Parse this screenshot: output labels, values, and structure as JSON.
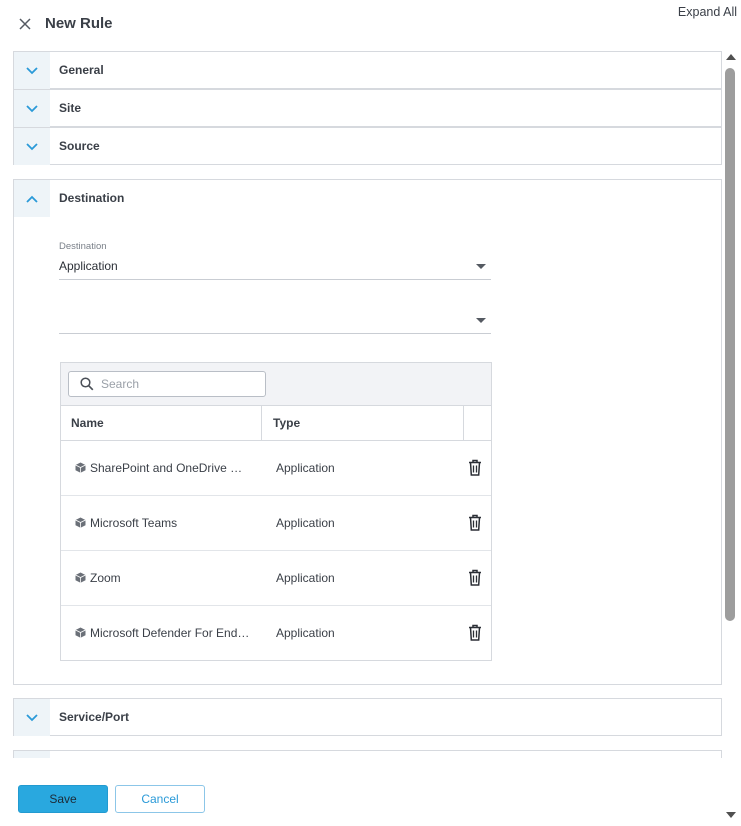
{
  "header": {
    "title": "New Rule",
    "expand_all": "Expand All"
  },
  "sections": {
    "general": "General",
    "site": "Site",
    "source": "Source",
    "destination": "Destination",
    "service_port": "Service/Port"
  },
  "destination": {
    "field_label": "Destination",
    "type_value": "Application",
    "second_value": "",
    "search_placeholder": "Search",
    "columns": {
      "name": "Name",
      "type": "Type"
    },
    "rows": [
      {
        "name": "SharePoint and OneDrive Bu…",
        "type": "Application"
      },
      {
        "name": "Microsoft Teams",
        "type": "Application"
      },
      {
        "name": "Zoom",
        "type": "Application"
      },
      {
        "name": "Microsoft Defender For End…",
        "type": "Application"
      }
    ]
  },
  "footer": {
    "save": "Save",
    "cancel": "Cancel"
  },
  "colors": {
    "accent": "#29a8df",
    "chevron": "#2a9ad8",
    "border": "#d6d9de"
  }
}
